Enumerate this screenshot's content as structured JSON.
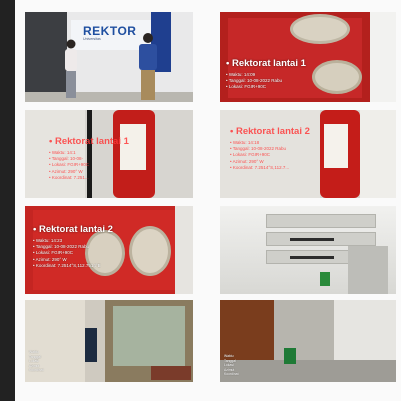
{
  "page_title": "",
  "photos": [
    {
      "id": "p1",
      "brand_text": "REKTOR",
      "brand_sub": "Universitas",
      "caption_lines": []
    },
    {
      "id": "p2",
      "title": "• Rektorat lantai 1",
      "caption_lines": [
        "• Waktu: 14:09",
        "• Tanggal: 10-08-2022 Rabu",
        "• Lokasi: FGIR+90C"
      ]
    },
    {
      "id": "p3",
      "title": "• Rektorat lantai 1",
      "caption_lines": [
        "• Waktu: 14:1",
        "• Tanggal: 10-08-",
        "• Lokasi: FGIR+90C",
        "• Azimut: 290° W",
        "• Koordinat: 7.251..."
      ]
    },
    {
      "id": "p4",
      "title": "• Rektorat lantai 2",
      "caption_lines": [
        "• Waktu: 14:18",
        "• Tanggal: 10-08-2022 Rabu",
        "• Lokasi: FGIR+90C",
        "• Azimut: 290° W",
        "• Koordinat: 7.2514°S,112.7..."
      ]
    },
    {
      "id": "p5",
      "title": "• Rektorat lantai 2",
      "caption_lines": [
        "• Waktu: 14:23",
        "• Tanggal: 10-08-2022 Rabu",
        "• Lokasi: FGIR+90C",
        "• Azimut: 290° W",
        "• Koordinat: 7.2514°S,112.7514°E"
      ]
    },
    {
      "id": "p6",
      "caption_lines": []
    },
    {
      "id": "p7",
      "caption_lines": [
        "Waktu",
        "Tanggal",
        "Lokasi",
        "Azimut",
        "Koordinat"
      ]
    },
    {
      "id": "p8",
      "caption_lines": [
        "Waktu",
        "Tanggal",
        "Lokasi",
        "Azimut",
        "Koordinat"
      ]
    }
  ]
}
